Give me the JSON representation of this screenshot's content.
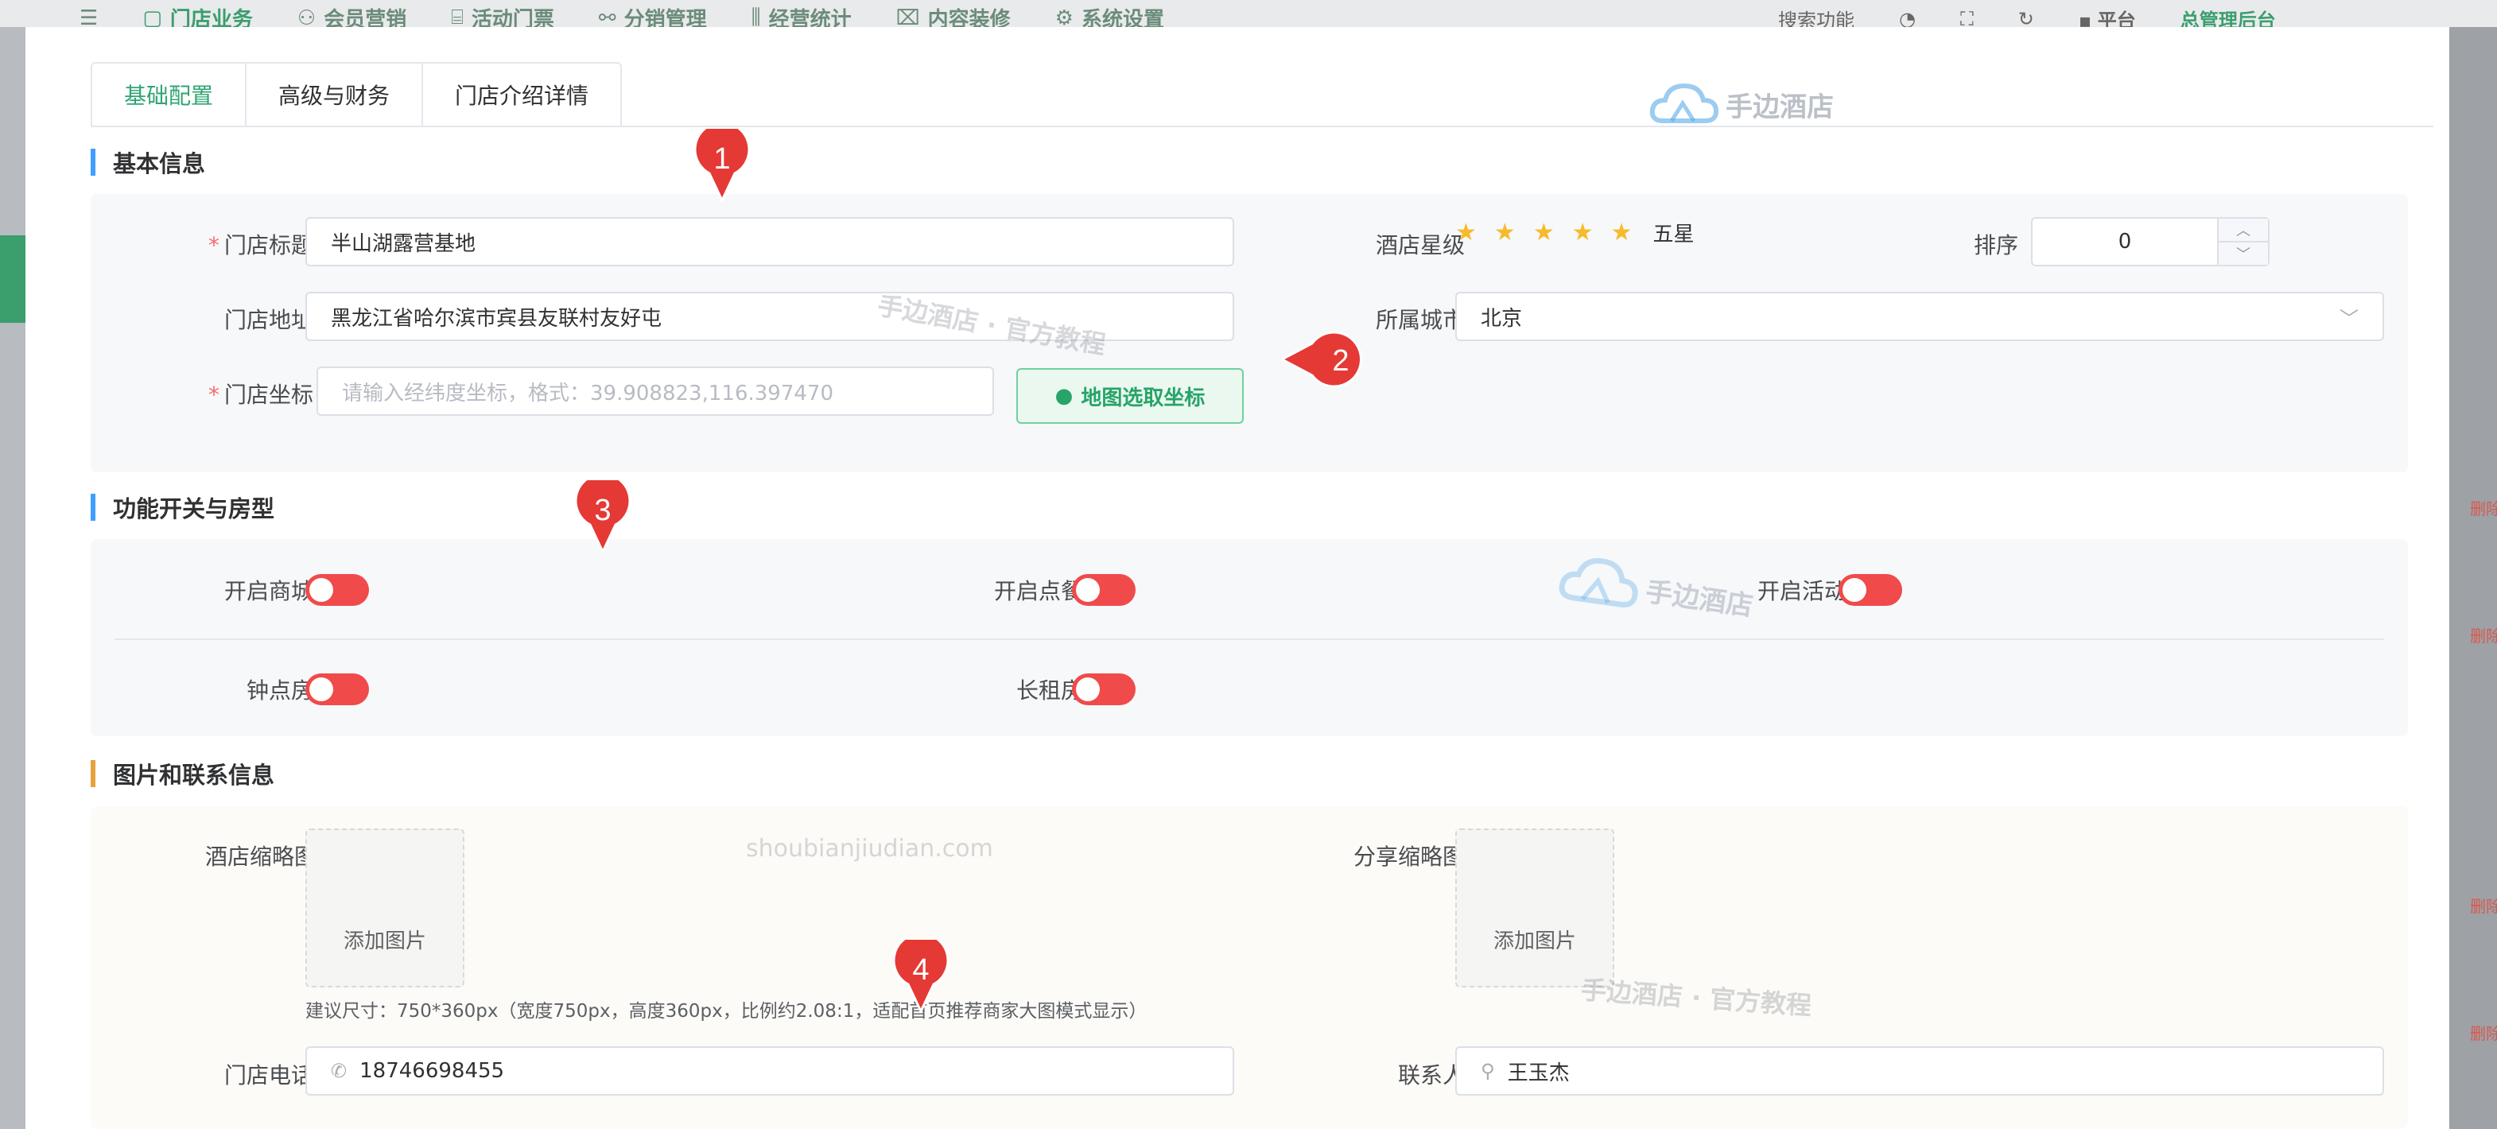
{
  "background": {
    "nav": [
      "门店业务",
      "会员营销",
      "活动门票",
      "分销管理",
      "经营统计",
      "内容装修",
      "系统设置"
    ],
    "right": {
      "search": "搜索功能",
      "platform": "平台",
      "admin": "总管理后台"
    },
    "side_text": "删除"
  },
  "tabs": [
    {
      "label": "基础配置",
      "active": true
    },
    {
      "label": "高级与财务",
      "active": false
    },
    {
      "label": "门店介绍详情",
      "active": false
    }
  ],
  "sections": {
    "basic": "基本信息",
    "features": "功能开关与房型",
    "images": "图片和联系信息"
  },
  "basic": {
    "store_title_label": "门店标题",
    "store_title_value": "半山湖露营基地",
    "address_label": "门店地址",
    "address_value": "黑龙江省哈尔滨市宾县友联村友好屯",
    "coord_label": "门店坐标",
    "coord_placeholder": "请输入经纬度坐标，格式：39.908823,116.397470",
    "map_button": "地图选取坐标",
    "star_label": "酒店星级",
    "star_rating": 5,
    "star_text": "五星",
    "sort_label": "排序",
    "sort_value": "0",
    "city_label": "所属城市",
    "city_value": "北京"
  },
  "features": {
    "toggles": [
      {
        "label": "开启商城",
        "on": true
      },
      {
        "label": "开启点餐",
        "on": true
      },
      {
        "label": "开启活动",
        "on": true
      },
      {
        "label": "钟点房",
        "on": true
      },
      {
        "label": "长租房",
        "on": true
      }
    ],
    "toggle_color": "#f04a4a"
  },
  "images": {
    "hotel_thumb_label": "酒店缩略图",
    "share_thumb_label": "分享缩略图",
    "add_image": "添加图片",
    "hint": "建议尺寸：750*360px（宽度750px，高度360px，比例约2.08:1，适配首页推荐商家大图模式显示）",
    "phone_label": "门店电话",
    "phone_value": "18746698455",
    "contact_label": "联系人",
    "contact_value": "王玉杰"
  },
  "watermarks": {
    "brand": "手边酒店",
    "tutorial": "手边酒店 · 官方教程",
    "domain": "shoubianjiudian.com"
  },
  "markers": [
    "1",
    "2",
    "3",
    "4"
  ],
  "colors": {
    "primary": "#2fa573",
    "accent_blue": "#409eff",
    "accent_orange": "#e6a23c",
    "marker": "#e53935"
  }
}
